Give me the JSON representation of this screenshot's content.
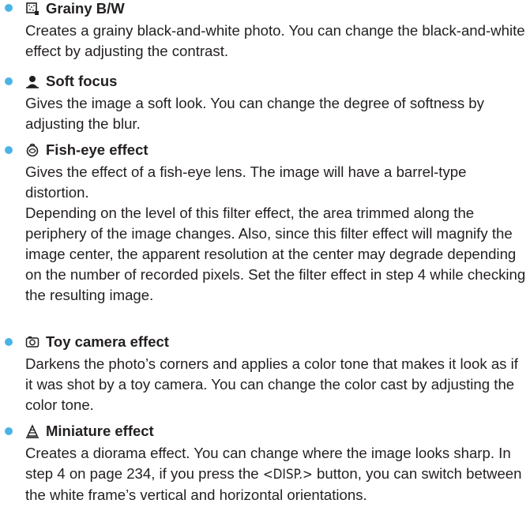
{
  "entries": [
    {
      "icon": "grainy-bw-icon",
      "title": "Grainy B/W",
      "paragraphs": [
        "Creates a grainy black-and-white photo. You can change the black-and-white effect by adjusting the contrast."
      ]
    },
    {
      "icon": "soft-focus-icon",
      "title": "Soft focus",
      "paragraphs": [
        "Gives the image a soft look. You can change the degree of softness by adjusting the blur."
      ]
    },
    {
      "icon": "fish-eye-icon",
      "title": "Fish-eye effect",
      "paragraphs": [
        "Gives the effect of a fish-eye lens. The image will have a barrel-type distortion.",
        "Depending on the level of this filter effect, the area trimmed along the periphery of the image changes. Also, since this filter effect will magnify the image center, the apparent resolution at the center may degrade depending on the number of recorded pixels. Set the filter effect in step 4 while checking the resulting image."
      ]
    },
    {
      "icon": "toy-camera-icon",
      "title": "Toy camera effect",
      "paragraphs": [
        "Darkens the photo’s corners and applies a color tone that makes it look as if it was shot by a toy camera. You can change the color cast by adjusting the color tone."
      ]
    },
    {
      "icon": "miniature-icon",
      "title": "Miniature effect",
      "p_before": "Creates a diorama effect. You can change where the image looks sharp. In step 4 on page 234, if you press the ",
      "p_button": "<DISP.>",
      "p_after": " button, you can switch between the white frame’s vertical and horizontal orientations."
    }
  ]
}
